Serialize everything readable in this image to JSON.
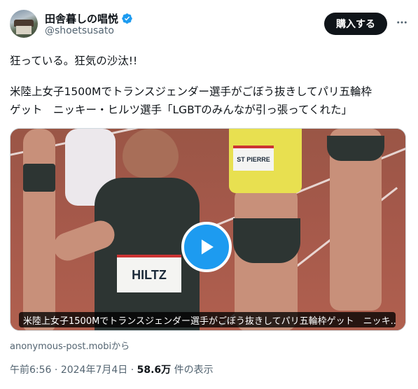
{
  "author": {
    "display_name": "田舎暮しの唱悦",
    "handle": "@shoetsusato",
    "verified_badge_color": "#1d9bf0"
  },
  "header": {
    "buy_button_label": "購入する",
    "more_icon": "more-icon"
  },
  "tweet": {
    "line1": "狂っている。狂気の沙汰!!",
    "line2": "米陸上女子1500Mでトランスジェンダー選手がごぼう抜きしてパリ五輪枠",
    "line3": "ゲット　ニッキー・ヒルツ選手「LGBTのみんなが引っ張ってくれた」"
  },
  "media": {
    "caption": "米陸上女子1500Mでトランスジェンダー選手がごぼう抜きしてパリ五輪枠ゲット　ニッキ...",
    "bib_main": "HILTZ",
    "bib_right": "ST PIERRE",
    "play_icon": "play-icon",
    "accent_color": "#1d9bf0"
  },
  "source": "anonymous-post.mobiから",
  "meta": {
    "time": "午前6:56",
    "separator": " · ",
    "date": "2024年7月4日",
    "views_count": "58.6万",
    "views_label": " 件の表示"
  }
}
